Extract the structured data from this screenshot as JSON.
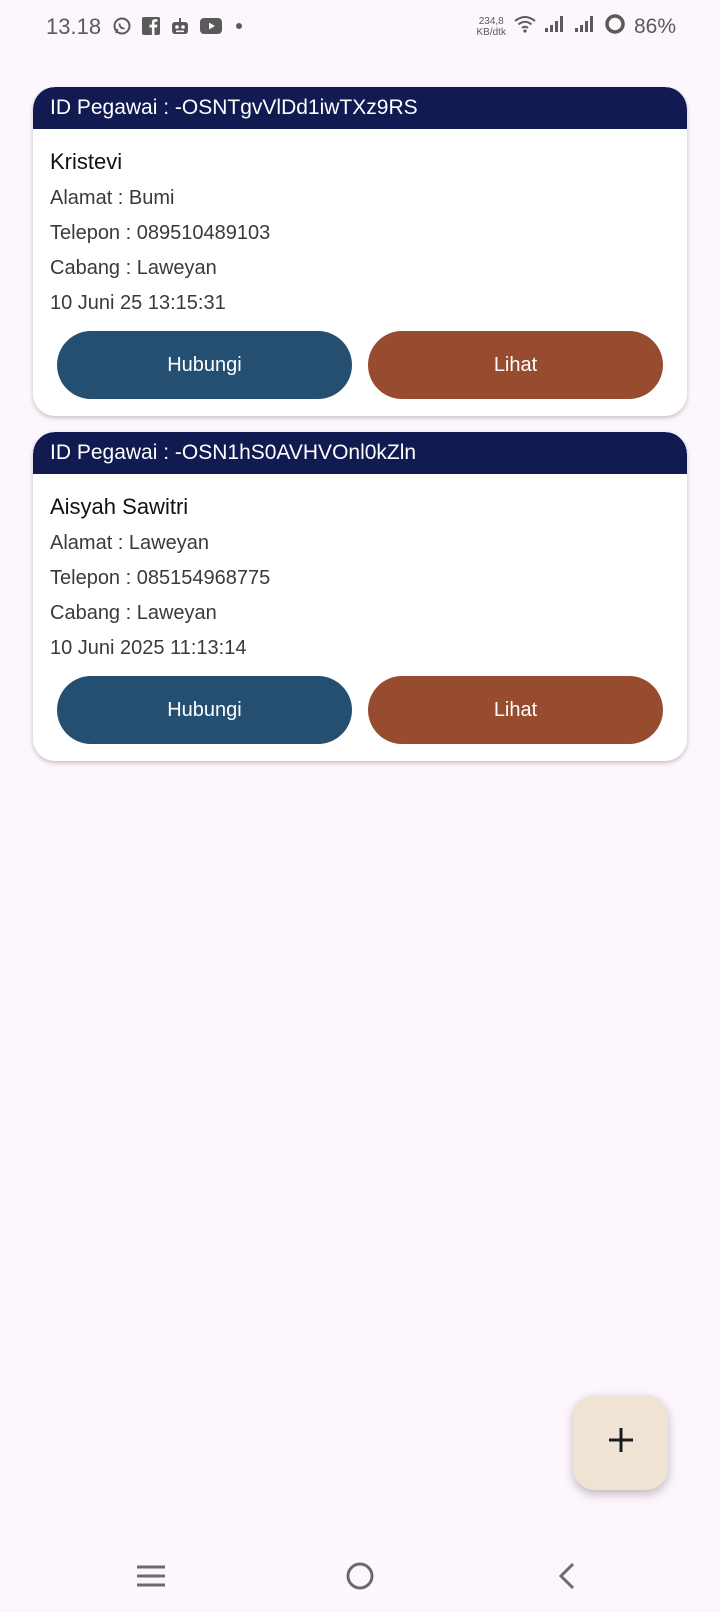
{
  "status_bar": {
    "time": "13.18",
    "net_speed_value": "234,8",
    "net_speed_unit": "KB/dtk",
    "battery": "86%",
    "icons": [
      "whatsapp-icon",
      "facebook-icon",
      "robot-icon",
      "youtube-icon",
      "dot-icon",
      "wifi-icon",
      "signal-icon",
      "signal-icon",
      "battery-ring-icon"
    ]
  },
  "employees": [
    {
      "id_label": "ID Pegawai : -OSNTgvVlDd1iwTXz9RS",
      "name": "Kristevi",
      "address": "Alamat : Bumi",
      "phone": "Telepon : 089510489103",
      "branch": "Cabang : Laweyan",
      "date": "10 Juni 25 13:15:31",
      "contact_label": "Hubungi",
      "view_label": "Lihat"
    },
    {
      "id_label": "ID Pegawai : -OSN1hS0AVHVOnl0kZln",
      "name": "Aisyah Sawitri",
      "address": "Alamat : Laweyan",
      "phone": "Telepon : 085154968775",
      "branch": "Cabang : Laweyan",
      "date": "10 Juni 2025 11:13:14",
      "contact_label": "Hubungi",
      "view_label": "Lihat"
    }
  ],
  "fab": {
    "icon": "plus-icon"
  },
  "nav": {
    "icons": [
      "menu-icon",
      "home-icon",
      "back-icon"
    ]
  },
  "colors": {
    "header": "#121a52",
    "contact_button": "#254f71",
    "view_button": "#974c2f",
    "fab": "#efe4d4",
    "background": "#fdf6fd"
  }
}
